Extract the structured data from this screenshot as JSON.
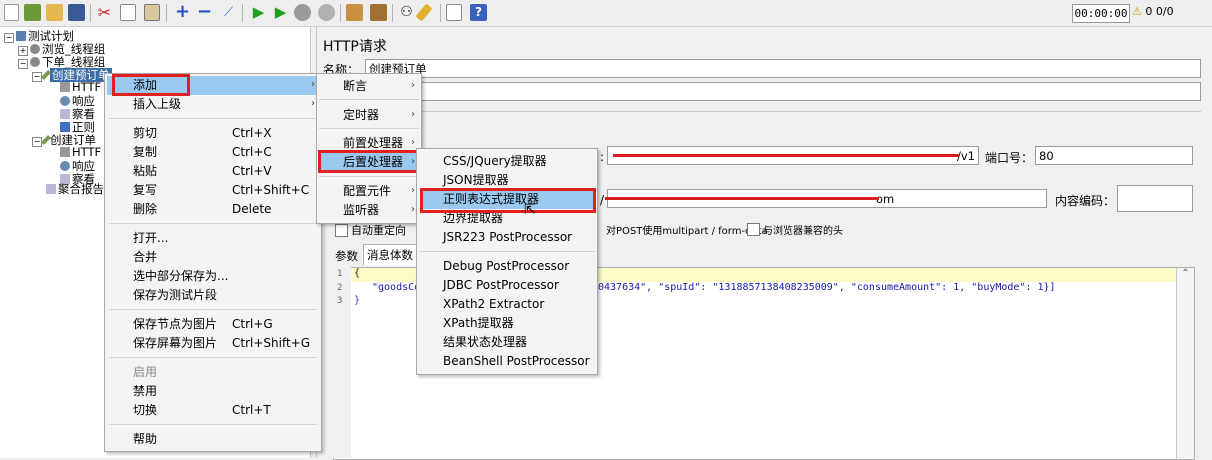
{
  "toolbar": {
    "timer": "00:00:00",
    "warn_count": "0",
    "thread_count": "0/0",
    "icons": [
      "new-icon",
      "templates-icon",
      "open-icon",
      "save-icon",
      "cut-icon",
      "copy-icon",
      "paste-icon",
      "expand-icon",
      "collapse-icon",
      "toggle-icon",
      "start-icon",
      "start-no-pause-icon",
      "stop-icon",
      "shutdown-icon",
      "clear-icon",
      "clear-all-icon",
      "search-icon",
      "reset-search-icon",
      "function-helper-icon",
      "help-icon"
    ]
  },
  "tree": {
    "root": "测试计划",
    "items": [
      "浏览_线程组",
      "下单_线程组",
      "创建预订单",
      "HTTF",
      "响应",
      "察看",
      "正则",
      "创建订单",
      "HTTF",
      "响应",
      "察看",
      "聚合报告"
    ]
  },
  "http_panel": {
    "title": "HTTP请求",
    "name_label": "名称：",
    "name_value": "创建预订单",
    "port_label": "端口号：",
    "port_value": "80",
    "path_suffix": "/v1",
    "encoding_label": "内容编码：",
    "auto_redirect": "自动重定向",
    "multipart": "对POST使用multipart / form-data",
    "browser_compat": "与浏览器兼容的头",
    "tab_params": "参数",
    "tab_body": "消息体数",
    "com_suffix": "om",
    "code_lines": [
      "{",
      "\"goodsCo",
      "0437634\", \"spuId\": \"1318857138408235009\", \"consumeAmount\": 1, \"buyMode\": 1}]",
      "}"
    ],
    "line_numbers": [
      "1",
      "2",
      "3"
    ]
  },
  "context_menu": {
    "items": [
      {
        "label": "添加",
        "shortcut": "",
        "arrow": true
      },
      {
        "label": "插入上级",
        "shortcut": "",
        "arrow": true
      },
      {
        "label": "剪切",
        "shortcut": "Ctrl+X"
      },
      {
        "label": "复制",
        "shortcut": "Ctrl+C"
      },
      {
        "label": "粘贴",
        "shortcut": "Ctrl+V"
      },
      {
        "label": "复写",
        "shortcut": "Ctrl+Shift+C"
      },
      {
        "label": "删除",
        "shortcut": "Delete"
      },
      {
        "label": "打开...",
        "shortcut": ""
      },
      {
        "label": "合并",
        "shortcut": ""
      },
      {
        "label": "选中部分保存为...",
        "shortcut": ""
      },
      {
        "label": "保存为测试片段",
        "shortcut": ""
      },
      {
        "label": "保存节点为图片",
        "shortcut": "Ctrl+G"
      },
      {
        "label": "保存屏幕为图片",
        "shortcut": "Ctrl+Shift+G"
      },
      {
        "label": "启用",
        "shortcut": ""
      },
      {
        "label": "禁用",
        "shortcut": ""
      },
      {
        "label": "切换",
        "shortcut": "Ctrl+T"
      },
      {
        "label": "帮助",
        "shortcut": ""
      }
    ]
  },
  "add_submenu": {
    "items": [
      "断言",
      "定时器",
      "前置处理器",
      "后置处理器",
      "配置元件",
      "监听器"
    ]
  },
  "post_processor_submenu": {
    "items": [
      "CSS/JQuery提取器",
      "JSON提取器",
      "正则表达式提取器",
      "边界提取器",
      "JSR223 PostProcessor",
      "Debug PostProcessor",
      "JDBC PostProcessor",
      "XPath2 Extractor",
      "XPath提取器",
      "结果状态处理器",
      "BeanShell PostProcessor"
    ]
  },
  "colors": {
    "highlight_border": "#e02020",
    "selection": "#99c8f0",
    "redaction": "#d81e1e"
  }
}
